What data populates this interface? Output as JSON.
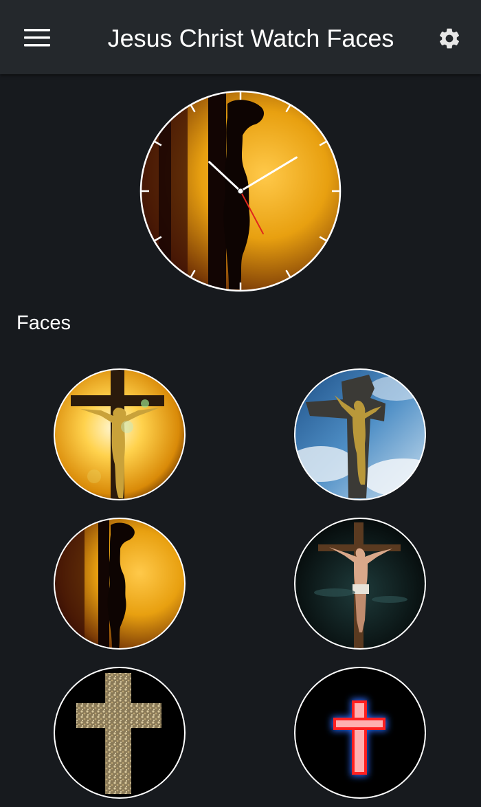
{
  "app": {
    "title": "Jesus Christ Watch Faces"
  },
  "icons": {
    "menu": "hamburger-menu-icon",
    "settings": "gear-icon"
  },
  "preview": {
    "hour_hand_angle_deg": 313,
    "minute_hand_angle_deg": 59,
    "second_hand_angle_deg": 152,
    "accent_color": "#e8a010",
    "second_hand_color": "#e0261c"
  },
  "faces_section": {
    "title": "Faces"
  },
  "faces": [
    {
      "theme": "golden-crucifix-glow"
    },
    {
      "theme": "stone-crucifix-blue-sky"
    },
    {
      "theme": "silhouette-crucifix-amber"
    },
    {
      "theme": "crucifix-dark-night"
    },
    {
      "theme": "mosaic-cross-black"
    },
    {
      "theme": "neon-red-cross"
    }
  ],
  "colors": {
    "background": "#171a1e",
    "toolbar": "#24282c",
    "text": "#ffffff"
  }
}
